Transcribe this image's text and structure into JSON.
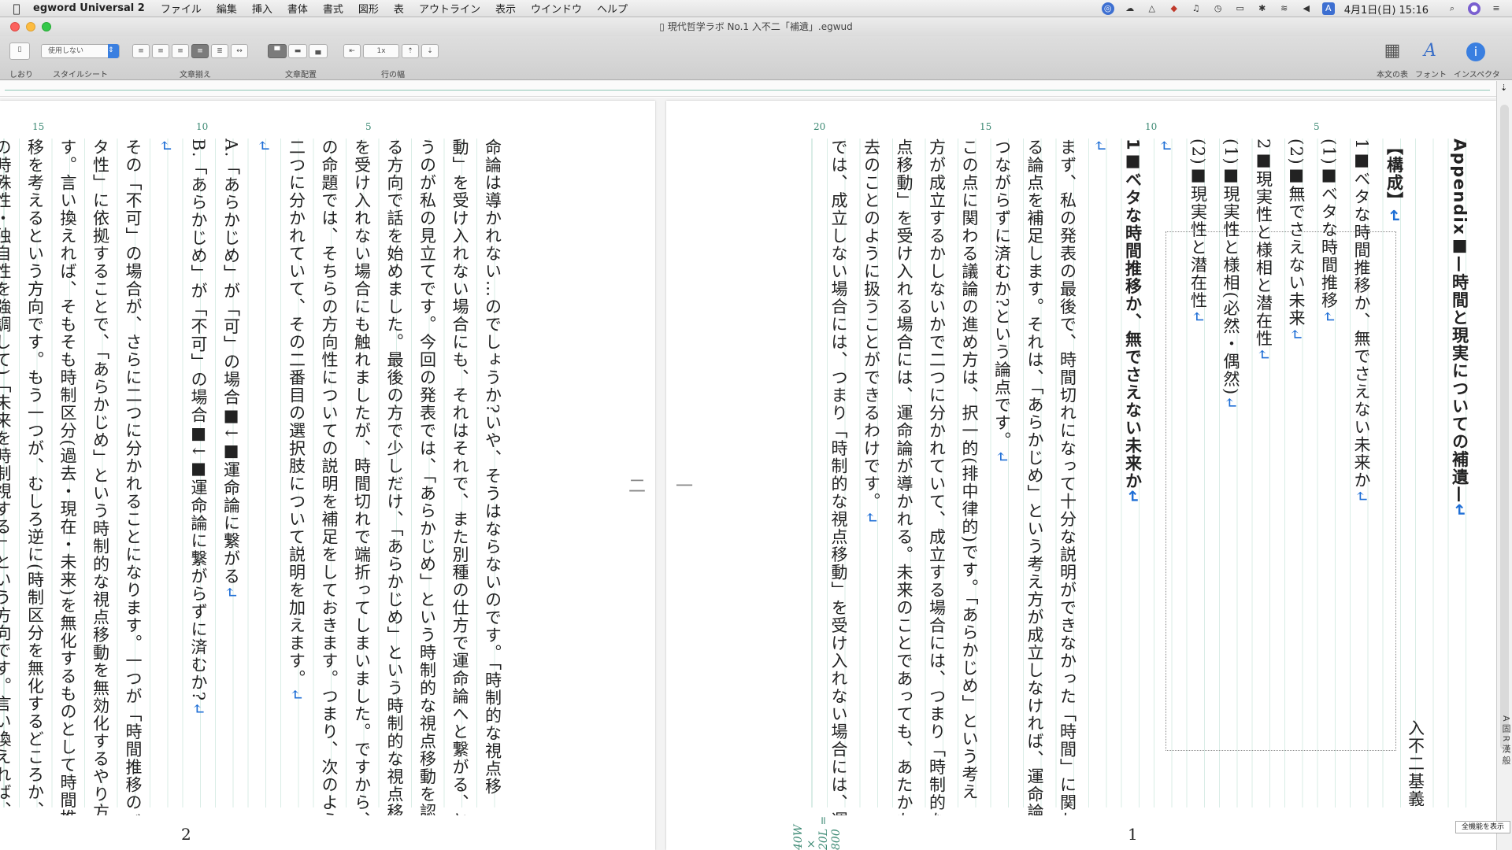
{
  "menubar": {
    "app_name": "egword Universal 2",
    "items": [
      "ファイル",
      "編集",
      "挿入",
      "書体",
      "書式",
      "図形",
      "表",
      "アウトライン",
      "表示",
      "ウインドウ",
      "ヘルプ"
    ],
    "clock": "4月1日(日)  15:16",
    "input_indicator": "A"
  },
  "window": {
    "title": "現代哲学ラボ No.1 入不二「補遺」.egwud"
  },
  "toolbar": {
    "bookmark_label": "しおり",
    "style_select_value": "使用しない",
    "stylesheet_label": "スタイルシート",
    "alignment_label": "文章揃え",
    "placement_label": "文章配置",
    "line_width_label": "行の幅",
    "line_width_value": "1x",
    "body_table_label": "本文の表",
    "font_label": "フォント",
    "inspector_label": "インスペクタ"
  },
  "document": {
    "column_numbers_left": [
      "15",
      "10",
      "5"
    ],
    "column_numbers_right": [
      "20",
      "15",
      "10",
      "5"
    ],
    "right_page_lines": [
      {
        "text": "Appendix■—時間と現実についての補遺—",
        "bold": true,
        "ret": true
      },
      {
        "text": "",
        "ret": false
      },
      {
        "text": "【構成】",
        "bold": true,
        "ret": true
      },
      {
        "text": "1■ベタな時間推移か、無でさえない未来か",
        "bold": false,
        "ret": true
      },
      {
        "text": "(1)■ベタな時間推移",
        "bold": false,
        "ret": true
      },
      {
        "text": "(2)■無でさえない未来",
        "bold": false,
        "ret": true
      },
      {
        "text": "2■現実性と様相と潜在性",
        "bold": false,
        "ret": true
      },
      {
        "text": "(1)■現実性と様相(必然・偶然)",
        "bold": false,
        "ret": true
      },
      {
        "text": "(2)■現実性と潜在性",
        "bold": false,
        "ret": true
      },
      {
        "text": "",
        "ret": true
      },
      {
        "text": "1■ベタな時間推移か、無でさえない未来か",
        "bold": true,
        "ret": true
      },
      {
        "text": "",
        "ret": true
      },
      {
        "text": "まず、私の発表の最後で、時間切れになって十分な説明ができなかった「時間」に関わ",
        "bold": false,
        "ret": false
      },
      {
        "text": "る論点を補足します。それは、「あらかじめ」という考え方が成立しなければ、運命論に",
        "bold": false,
        "ret": false
      },
      {
        "text": "つながらずに済むか?という論点です。",
        "bold": false,
        "ret": true
      },
      {
        "text": "この点に関わる議論の進め方は、択一的(排中律的)です。「あらかじめ」という考え",
        "bold": false,
        "ret": false
      },
      {
        "text": "方が成立するかしないかで二つに分かれていて、成立する場合には、つまり「時制的な視",
        "bold": false,
        "ret": false
      },
      {
        "text": "点移動」を受け入れる場合には、運命論が導かれる。未来のことであっても、あたかも過",
        "bold": false,
        "ret": false
      },
      {
        "text": "去のことのように扱うことができるわけです。",
        "bold": false,
        "ret": true
      },
      {
        "text": "では、成立しない場合には、つまり「時制的な視点移動」を受け入れない場合には、運",
        "bold": false,
        "ret": false
      }
    ],
    "left_page_lines": [
      {
        "text": "命論は導かれない…のでしょうか?いや、そうはならないのです。「時制的な視点移",
        "ret": false
      },
      {
        "text": "動」を受け入れない場合にも、それはそれで、また別種の仕方で運命論へと繋がる、とい",
        "ret": false
      },
      {
        "text": "うのが私の見立てです。今回の発表では、「あらかじめ」という時制的な視点移動を認め",
        "ret": false
      },
      {
        "text": "る方向で話を始めました。最後の方で少しだけ、「あらかじめ」という時制的な視点移動",
        "ret": false
      },
      {
        "text": "を受け入れない場合にも触れましたが、時間切れで端折ってしまいました。ですから、こ",
        "ret": false
      },
      {
        "text": "の命題では、そちらの方向性についての説明を補足をしておきます。つまり、次のように",
        "ret": false
      },
      {
        "text": "二つに分かれていて、その二番目の選択肢について説明を加えます。",
        "ret": true
      },
      {
        "text": "",
        "ret": true
      },
      {
        "text": "A.「あらかじめ」が「可」の場合■↓■運命論に繋がる",
        "ret": true
      },
      {
        "text": "B.「あらかじめ」が「不可」の場合■↓■運命論に繋がらずに済むか?",
        "ret": true
      },
      {
        "text": "",
        "ret": true
      },
      {
        "text": "その「不可」の場合が、さらに二つに分かれることになります。一つが「時間推移のベ",
        "ret": false
      },
      {
        "text": "タ性」に依拠することで、「あらかじめ」という時制的な視点移動を無効化するやり方で",
        "ret": false
      },
      {
        "text": "す。言い換えれば、そもそも時制区分(過去・現在・未来)を無化するものとして時間推",
        "ret": false
      },
      {
        "text": "移を考えるという方向です。もう一つが、むしろ逆に(時制区分を無化するどころか、そ",
        "ret": false
      },
      {
        "text": "の時殊性・独自性を強調して)「未来を時制視する」という方向です。言い換えれば、",
        "ret": false
      }
    ],
    "page_left_number": "2",
    "page_right_number": "1",
    "center_marks": [
      "二",
      "一"
    ],
    "counter": "40W × 20L = 800",
    "frame_title": "入不二基義"
  },
  "side_panel": {
    "input_labels": "A 固 R 漢 般",
    "show_all_button": "全機能を表示"
  }
}
